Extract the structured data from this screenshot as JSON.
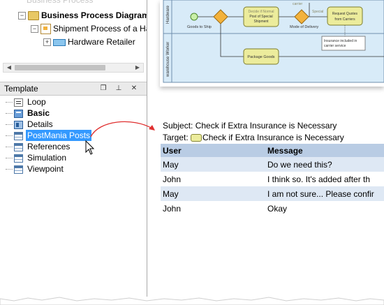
{
  "model_tree": {
    "faded_item": "Business Process",
    "items": [
      {
        "label": "Business Process Diagram",
        "bold": true
      },
      {
        "label": "Shipment Process of a Hard"
      },
      {
        "label": "Hardware Retailer"
      }
    ]
  },
  "template_panel": {
    "title": "Template",
    "buttons": {
      "restore": "❐",
      "pin": "⊥",
      "close": "✕"
    },
    "items": [
      {
        "label": "Loop",
        "icon": "loop-icon"
      },
      {
        "label": "Basic",
        "icon": "basic-icon",
        "bold": true
      },
      {
        "label": "Details",
        "icon": "details-icon"
      },
      {
        "label": "PostMania Posts",
        "icon": "table-icon",
        "selected": true
      },
      {
        "label": "References",
        "icon": "table-icon"
      },
      {
        "label": "Simulation",
        "icon": "table-icon"
      },
      {
        "label": "Viewpoint",
        "icon": "table-icon"
      }
    ]
  },
  "diagram": {
    "lane_labels": [
      "Hardware",
      "warehouse Worker"
    ],
    "task_goods_to_ship": "Goods to Ship",
    "task_special_shipment": [
      "Decide if Normal",
      "Post of Special",
      "Shipment"
    ],
    "label_mode_of_delivery": "Mode of Delivery",
    "label_carrier": "carrier",
    "label_special": "Special",
    "task_request_quotes": [
      "Request Quotes",
      "from Carriers"
    ],
    "note_text": [
      "Insurance included in",
      "carrier service"
    ],
    "task_package_goods": "Package Goods"
  },
  "post": {
    "subject": "Subject: Check if Extra Insurance is Necessary",
    "target_prefix": "Target: ",
    "target_text": "Check if Extra Insurance is Necessary"
  },
  "messages_table": {
    "headers": [
      "User",
      "Message"
    ],
    "rows": [
      {
        "user": "May",
        "message": "Do we need this?"
      },
      {
        "user": "John",
        "message": "I think so. It's added after th"
      },
      {
        "user": "May",
        "message": "I am not sure... Please confir"
      },
      {
        "user": "John",
        "message": "Okay"
      }
    ]
  },
  "colors": {
    "selection": "#3399ff",
    "table_header": "#b9cce4",
    "table_alt_row": "#dee8f4",
    "task_fill": "#ecec9c",
    "gateway_fill": "#f3b23c",
    "lane_fill": "#d8ebf8",
    "callout_arrow": "#e03030"
  }
}
